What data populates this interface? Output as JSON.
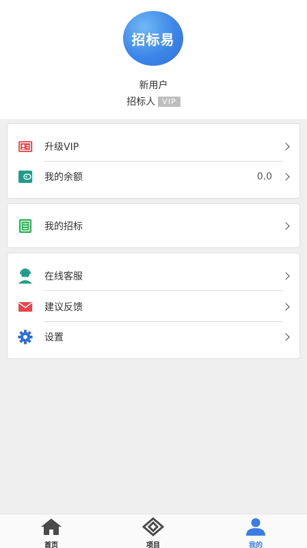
{
  "profile": {
    "logo_text": "招标易",
    "username": "新用户",
    "role": "招标人",
    "vip_tag": "VIP"
  },
  "menu": {
    "upgrade_vip": "升级VIP",
    "balance_label": "我的余额",
    "balance_value": "0.0",
    "my_bids": "我的招标",
    "online_service": "在线客服",
    "feedback": "建议反馈",
    "settings": "设置"
  },
  "tabbar": {
    "home": "首页",
    "projects": "项目",
    "mine": "我的",
    "active": "mine",
    "active_color": "#3b7de0",
    "inactive_color": "#222222"
  },
  "colors": {
    "vip_icon": "#e8464a",
    "wallet_icon": "#1f9c8a",
    "bids_icon": "#2db255",
    "service_icon": "#1f9c8a",
    "mail_icon": "#e8464a",
    "gear_icon": "#2f6fd8"
  }
}
